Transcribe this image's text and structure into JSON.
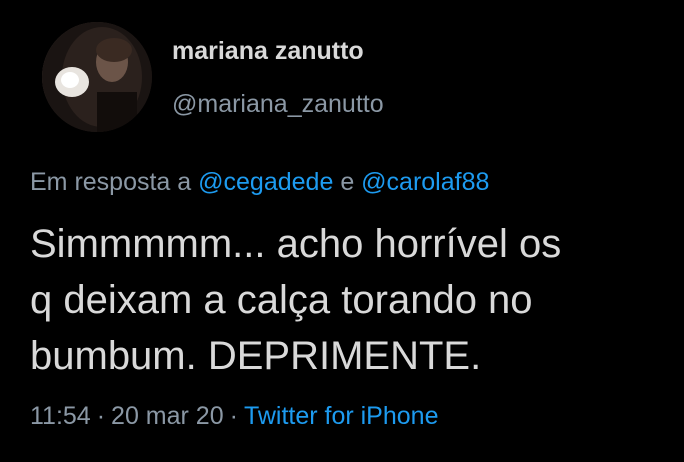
{
  "tweet": {
    "author": {
      "display_name": "mariana zanutto",
      "handle": "@mariana_zanutto",
      "avatar_icon": "profile-photo"
    },
    "reply": {
      "prefix": "Em resposta a",
      "mention_1": "@cegadede",
      "conjunction": "e",
      "mention_2": "@carolaf88"
    },
    "text_lines": [
      "Simmmmm... acho horrível os",
      "q deixam a calça torando no",
      "bumbum. DEPRIMENTE."
    ],
    "time": "11:54",
    "separator": "·",
    "date": "20 mar 20",
    "source": "Twitter for iPhone"
  },
  "colors": {
    "background": "#000000",
    "text": "#d9d9d9",
    "muted": "#8b98a5",
    "accent": "#1d9bf0"
  }
}
